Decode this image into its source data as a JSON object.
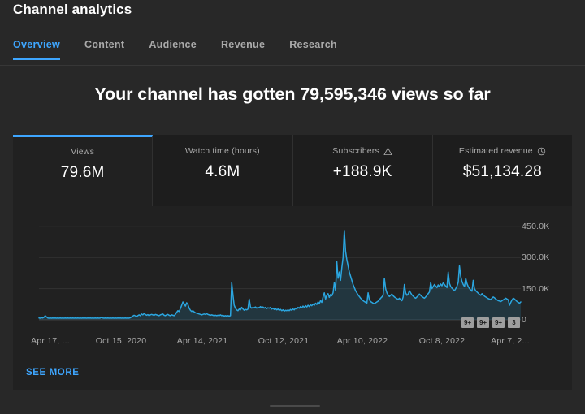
{
  "header": {
    "title": "Channel analytics",
    "tabs": [
      {
        "label": "Overview",
        "active": true
      },
      {
        "label": "Content",
        "active": false
      },
      {
        "label": "Audience",
        "active": false
      },
      {
        "label": "Revenue",
        "active": false
      },
      {
        "label": "Research",
        "active": false
      }
    ]
  },
  "headline": "Your channel has gotten 79,595,346 views so far",
  "metrics": [
    {
      "label": "Views",
      "value": "79.6M",
      "icon": "",
      "active": true
    },
    {
      "label": "Watch time (hours)",
      "value": "4.6M",
      "icon": "",
      "active": false
    },
    {
      "label": "Subscribers",
      "value": "+188.9K",
      "icon": "warning-triangle-icon",
      "active": false
    },
    {
      "label": "Estimated revenue",
      "value": "$51,134.28",
      "icon": "clock-icon",
      "active": false
    }
  ],
  "annotation_badges": [
    "9+",
    "9+",
    "9+",
    "3"
  ],
  "see_more_label": "SEE MORE",
  "colors": {
    "accent": "#3ea6ff",
    "line": "#2ba6e0",
    "page_bg": "#282828",
    "card_bg": "#1d1d1d",
    "card_active_bg": "#212121",
    "grid": "#323232",
    "muted_text": "#aaaaaa"
  },
  "chart_data": {
    "type": "area",
    "title": "",
    "xlabel": "",
    "ylabel": "",
    "grid": true,
    "legend": "none",
    "ylim": [
      0,
      500000
    ],
    "y_ticks": [
      450000,
      300000,
      150000,
      0
    ],
    "y_tick_labels": [
      "450.0K",
      "300.0K",
      "150.0K",
      "0"
    ],
    "x_tick_labels": [
      "Apr 17, ...",
      "Oct 15, 2020",
      "Apr 14, 2021",
      "Oct 12, 2021",
      "Apr 10, 2022",
      "Oct 8, 2022",
      "Apr 7, 2..."
    ],
    "x_tick_positions": [
      46,
      133,
      233,
      333,
      430,
      528,
      612
    ],
    "series": [
      {
        "name": "Views",
        "values": [
          9000,
          8000,
          10000,
          9000,
          12000,
          20000,
          14000,
          9000,
          8000,
          9000,
          8000,
          9000,
          8000,
          9000,
          8000,
          9000,
          8000,
          9000,
          8000,
          9000,
          8000,
          9000,
          8000,
          9000,
          8000,
          9000,
          8000,
          9000,
          8000,
          9000,
          8000,
          9000,
          8000,
          9000,
          8000,
          9000,
          8000,
          9000,
          8000,
          9000,
          8000,
          9000,
          8000,
          9000,
          8000,
          9000,
          8000,
          9000,
          8000,
          9000,
          12000,
          9000,
          8000,
          9000,
          8000,
          9000,
          8000,
          9000,
          8000,
          9000,
          8000,
          9000,
          8000,
          9000,
          8000,
          9000,
          8000,
          9000,
          8000,
          9000,
          8000,
          9000,
          8000,
          10000,
          14000,
          18000,
          22000,
          19000,
          16000,
          20000,
          24000,
          20000,
          28000,
          24000,
          30000,
          26000,
          22000,
          25000,
          20000,
          24000,
          26000,
          24000,
          22000,
          26000,
          24000,
          22000,
          20000,
          24000,
          26000,
          28000,
          22000,
          20000,
          24000,
          26000,
          22000,
          20000,
          24000,
          22000,
          20000,
          26000,
          36000,
          44000,
          40000,
          54000,
          70000,
          86000,
          78000,
          66000,
          82000,
          74000,
          56000,
          46000,
          40000,
          44000,
          38000,
          34000,
          32000,
          30000,
          28000,
          26000,
          24000,
          26000,
          28000,
          26000,
          30000,
          26000,
          24000,
          22000,
          24000,
          22000,
          20000,
          22000,
          20000,
          22000,
          20000,
          24000,
          20000,
          22000,
          18000,
          20000,
          18000,
          20000,
          18000,
          20000,
          180000,
          120000,
          70000,
          56000,
          48000,
          44000,
          52000,
          48000,
          60000,
          52000,
          46000,
          50000,
          48000,
          52000,
          100000,
          62000,
          56000,
          60000,
          58000,
          62000,
          56000,
          60000,
          58000,
          64000,
          58000,
          62000,
          56000,
          60000,
          54000,
          58000,
          56000,
          60000,
          52000,
          56000,
          50000,
          54000,
          48000,
          52000,
          46000,
          50000,
          44000,
          48000,
          42000,
          46000,
          44000,
          48000,
          44000,
          50000,
          46000,
          52000,
          48000,
          56000,
          52000,
          60000,
          56000,
          64000,
          58000,
          66000,
          60000,
          68000,
          62000,
          70000,
          64000,
          72000,
          68000,
          76000,
          70000,
          80000,
          74000,
          86000,
          78000,
          92000,
          84000,
          110000,
          130000,
          100000,
          118000,
          126000,
          108000,
          122000,
          116000,
          130000,
          180000,
          140000,
          280000,
          200000,
          230000,
          190000,
          250000,
          300000,
          430000,
          330000,
          290000,
          260000,
          230000,
          210000,
          190000,
          170000,
          155000,
          140000,
          130000,
          120000,
          112000,
          104000,
          98000,
          92000,
          88000,
          84000,
          80000,
          130000,
          96000,
          88000,
          84000,
          80000,
          78000,
          82000,
          86000,
          90000,
          96000,
          104000,
          110000,
          118000,
          200000,
          150000,
          130000,
          120000,
          112000,
          118000,
          124000,
          116000,
          110000,
          106000,
          102000,
          98000,
          104000,
          96000,
          92000,
          110000,
          170000,
          130000,
          118000,
          124000,
          140000,
          130000,
          120000,
          114000,
          108000,
          104000,
          110000,
          116000,
          124000,
          118000,
          112000,
          108000,
          104000,
          110000,
          118000,
          126000,
          134000,
          180000,
          150000,
          160000,
          170000,
          162000,
          155000,
          168000,
          160000,
          172000,
          164000,
          178000,
          170000,
          162000,
          155000,
          230000,
          175000,
          160000,
          152000,
          146000,
          140000,
          150000,
          162000,
          180000,
          260000,
          210000,
          185000,
          170000,
          160000,
          200000,
          175000,
          160000,
          150000,
          144000,
          138000,
          190000,
          150000,
          140000,
          134000,
          128000,
          122000,
          118000,
          126000,
          120000,
          114000,
          110000,
          106000,
          102000,
          100000,
          98000,
          104000,
          110000,
          106000,
          100000,
          96000,
          92000,
          90000,
          88000,
          92000,
          96000,
          100000,
          104000,
          100000,
          96000,
          70000,
          84000,
          96000,
          104000,
          100000,
          94000,
          88000,
          84000,
          80000,
          86000
        ]
      }
    ]
  }
}
